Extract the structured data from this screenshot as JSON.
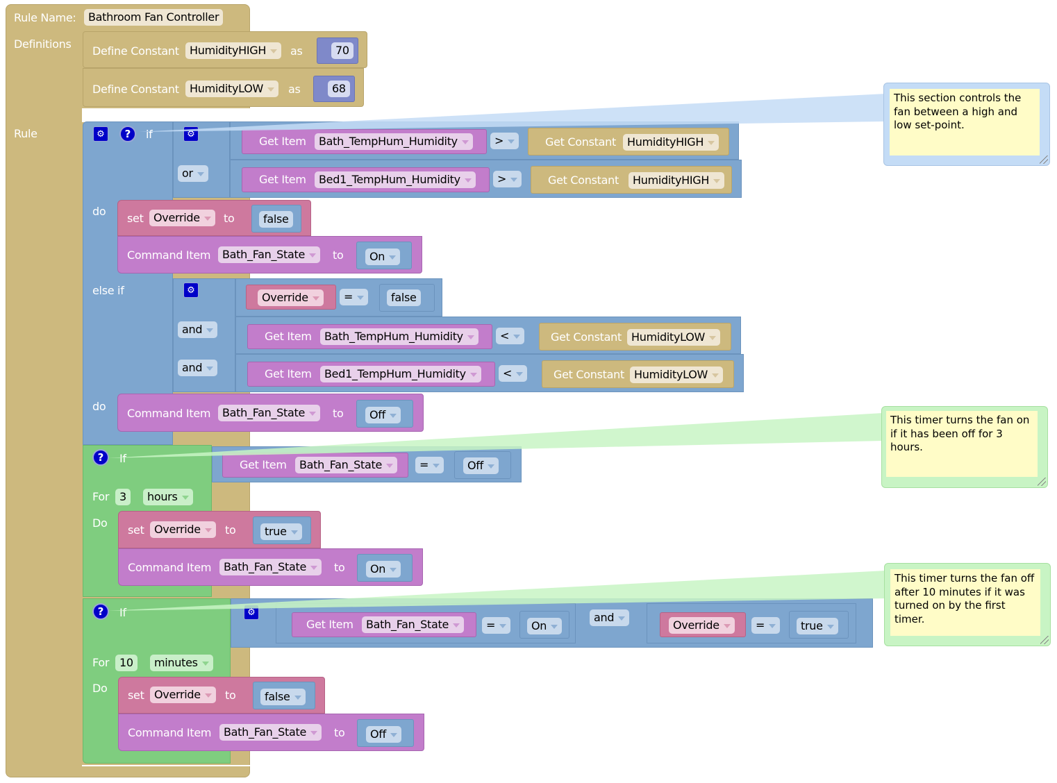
{
  "rule": {
    "name_label": "Rule Name:",
    "name_value": "Bathroom Fan Controller",
    "definitions_label": "Definitions",
    "rule_label": "Rule"
  },
  "definitions": [
    {
      "keyword": "Define Constant",
      "name": "HumidityHIGH",
      "as_label": "as",
      "value": "70"
    },
    {
      "keyword": "Define Constant",
      "name": "HumidityLOW",
      "as_label": "as",
      "value": "68"
    }
  ],
  "if_block": {
    "if_label": "if",
    "do_label": "do",
    "elseif_label": "else if",
    "do2_label": "do",
    "condition1": [
      {
        "joiner": "",
        "get_item_label": "Get Item",
        "item": "Bath_TempHum_Humidity",
        "op": ">",
        "get_constant_label": "Get Constant",
        "constant": "HumidityHIGH"
      },
      {
        "joiner": "or",
        "get_item_label": "Get Item",
        "item": "Bed1_TempHum_Humidity",
        "op": ">",
        "get_constant_label": "Get Constant",
        "constant": "HumidityHIGH"
      }
    ],
    "do1": {
      "set": {
        "set_label": "set",
        "variable": "Override",
        "to_label": "to",
        "value": "false"
      },
      "command": {
        "label": "Command Item",
        "item": "Bath_Fan_State",
        "to_label": "to",
        "value": "On"
      }
    },
    "condition2": {
      "first": {
        "variable": "Override",
        "op": "=",
        "value": "false"
      },
      "rows": [
        {
          "joiner": "and",
          "get_item_label": "Get Item",
          "item": "Bath_TempHum_Humidity",
          "op": "<",
          "get_constant_label": "Get Constant",
          "constant": "HumidityLOW"
        },
        {
          "joiner": "and",
          "get_item_label": "Get Item",
          "item": "Bed1_TempHum_Humidity",
          "op": "<",
          "get_constant_label": "Get Constant",
          "constant": "HumidityLOW"
        }
      ]
    },
    "do2": {
      "command": {
        "label": "Command Item",
        "item": "Bath_Fan_State",
        "to_label": "to",
        "value": "Off"
      }
    }
  },
  "timer1": {
    "if_label": "If",
    "condition": {
      "get_item_label": "Get Item",
      "item": "Bath_Fan_State",
      "op": "=",
      "value": "Off"
    },
    "for_label": "For",
    "duration": "3",
    "unit": "hours",
    "do_label": "Do",
    "set": {
      "set_label": "set",
      "variable": "Override",
      "to_label": "to",
      "value": "true"
    },
    "command": {
      "label": "Command Item",
      "item": "Bath_Fan_State",
      "to_label": "to",
      "value": "On"
    }
  },
  "timer2": {
    "if_label": "If",
    "condition": {
      "left": {
        "get_item_label": "Get Item",
        "item": "Bath_Fan_State",
        "op": "=",
        "value": "On"
      },
      "joiner": "and",
      "right": {
        "variable": "Override",
        "op": "=",
        "value": "true"
      }
    },
    "for_label": "For",
    "duration": "10",
    "unit": "minutes",
    "do_label": "Do",
    "set": {
      "set_label": "set",
      "variable": "Override",
      "to_label": "to",
      "value": "false"
    },
    "command": {
      "label": "Command Item",
      "item": "Bath_Fan_State",
      "to_label": "to",
      "value": "Off"
    }
  },
  "comments": [
    {
      "text": "This section controls the fan between a high and low set-point.",
      "color": "#c4dcf6"
    },
    {
      "text": "This timer turns the fan on if it has been off for 3 hours.",
      "color": "#c8f4c4"
    },
    {
      "text": "This timer turns the fan off after 10 minutes if it was turned on by the first timer.",
      "color": "#c8f4c4"
    }
  ],
  "colors": {
    "rule_tan": "#cdb97e",
    "logic_blue": "#7ea6cf",
    "item_purple": "#c27dcb",
    "variable_pink": "#ce799e",
    "timer_green": "#7fcd7f",
    "number_indigo": "#7f89c9",
    "mutator_blue": "#0000c8",
    "comment_bg": "#fffcc7"
  }
}
